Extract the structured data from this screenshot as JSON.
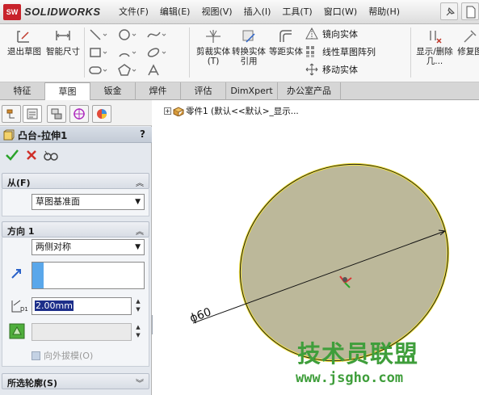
{
  "app": {
    "logo_badge": "SW",
    "logo_text": "SOLIDWORKS"
  },
  "menu": [
    "文件(F)",
    "编辑(E)",
    "视图(V)",
    "插入(I)",
    "工具(T)",
    "窗口(W)",
    "帮助(H)"
  ],
  "commands": {
    "exit_sketch": "退出草图",
    "smart_dim": "智能尺寸",
    "trim": "剪裁实体(T)",
    "convert": "转换实体引用",
    "offset": "等距实体",
    "mirror": "镜向实体",
    "linear_pattern": "线性草图阵列",
    "move": "移动实体",
    "show_delete": "显示/删除几...",
    "repair": "修复图"
  },
  "tabs": [
    "特征",
    "草图",
    "钣金",
    "焊件",
    "评估",
    "DimXpert",
    "办公室产品"
  ],
  "active_tab": "草图",
  "property_manager": {
    "title": "凸台-拉伸1",
    "help": "?",
    "from": {
      "header": "从(F)",
      "value": "草图基准面"
    },
    "direction1": {
      "header": "方向 1",
      "end_condition": "两侧对称",
      "depth": "2.00mm",
      "depth_icon_label": "D1",
      "draft_label": "向外拔模(O)"
    },
    "contours": {
      "header": "所选轮廓(S)"
    }
  },
  "feature_tree": {
    "expander": "+",
    "item": "零件1 (默认<<默认>_显示..."
  },
  "model": {
    "dimension_label": "ϕ60",
    "face_color": "#bcb89a",
    "edge_color": "#f3e33a"
  },
  "watermark": {
    "text": "技术员联盟",
    "url": "www.jsgho.com"
  },
  "colors": {
    "accent_green": "#3f9e3b",
    "list_selection": "#5aa7ea",
    "logo_red": "#c8232b"
  }
}
